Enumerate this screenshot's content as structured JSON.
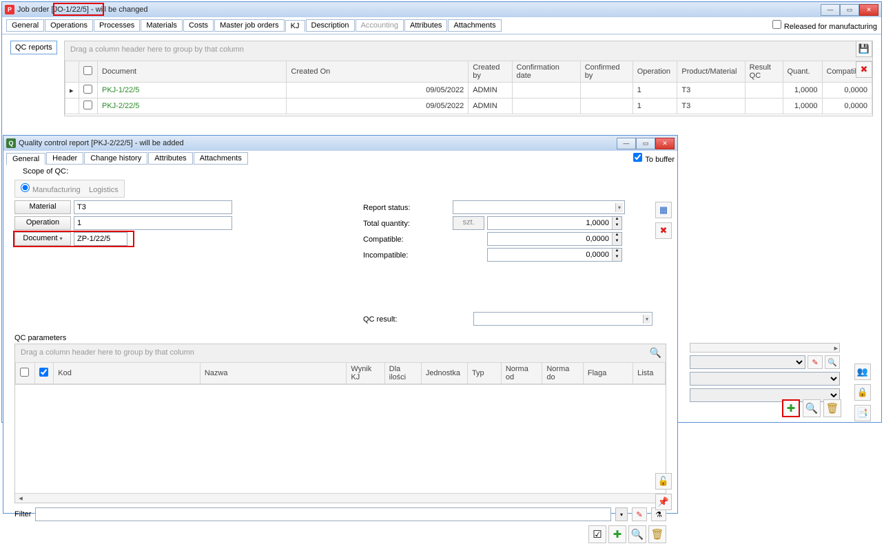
{
  "main_window": {
    "icon_letter": "P",
    "title": "Job order [JO-1/22/5] - will be changed",
    "released_label": "Released for manufacturing",
    "tabs": [
      "General",
      "Operations",
      "Processes",
      "Materials",
      "Costs",
      "Master job orders",
      "KJ",
      "Description",
      "Accounting",
      "Attributes",
      "Attachments"
    ],
    "active_tab": "KJ",
    "disabled_tab": "Accounting",
    "side_tab": "QC reports",
    "group_hint": "Drag a column header here to group by that column",
    "columns": [
      "Document",
      "Created On",
      "Created by",
      "Confirmation date",
      "Confirmed by",
      "Operation",
      "Product/Material",
      "Result QC",
      "Quant.",
      "Compatible"
    ],
    "rows": [
      {
        "doc": "PKJ-1/22/5",
        "created": "09/05/2022",
        "by": "ADMIN",
        "op": "1",
        "prod": "T3",
        "quant": "1,0000",
        "comp": "0,0000"
      },
      {
        "doc": "PKJ-2/22/5",
        "created": "09/05/2022",
        "by": "ADMIN",
        "op": "1",
        "prod": "T3",
        "quant": "1,0000",
        "comp": "0,0000"
      }
    ]
  },
  "dialog": {
    "icon_letter": "Q",
    "title": "Quality control report [PKJ-2/22/5] - will be added",
    "to_buffer_label": "To buffer",
    "tabs": [
      "General",
      "Header",
      "Change history",
      "Attributes",
      "Attachments"
    ],
    "active_tab": "General",
    "scope_label": "Scope of QC:",
    "scope_opts": [
      "Manufacturing",
      "Logistics"
    ],
    "left_fields": {
      "material_label": "Material",
      "material_value": "T3",
      "operation_label": "Operation",
      "operation_value": "1",
      "document_label": "Document",
      "document_value": "ZP-1/22/5"
    },
    "right_fields": {
      "status_label": "Report status:",
      "total_label": "Total quantity:",
      "total_unit": "szt.",
      "total_value": "1,0000",
      "compat_label": "Compatible:",
      "compat_value": "0,0000",
      "incompat_label": "Incompatible:",
      "incompat_value": "0,0000",
      "qcresult_label": "QC result:"
    },
    "params_title": "QC parameters",
    "params_group_hint": "Drag a column header here to group by that column",
    "params_cols": [
      "Kod",
      "Nazwa",
      "Wynik KJ",
      "Dla ilości",
      "Jednostka",
      "Typ",
      "Norma od",
      "Norma do",
      "Flaga",
      "Lista"
    ],
    "filter_label": "Filter"
  },
  "icons": {
    "save": "💾",
    "delete": "✖",
    "search": "🔍",
    "plus": "✚",
    "trash": "🗑",
    "magnify": "🔍",
    "check": "☑",
    "edit": "✎",
    "funnel": "⚗",
    "people": "👥",
    "lock": "🔒",
    "bookmark": "📑",
    "pin": "📌",
    "chip": "▦",
    "lock_open": "🔓"
  }
}
